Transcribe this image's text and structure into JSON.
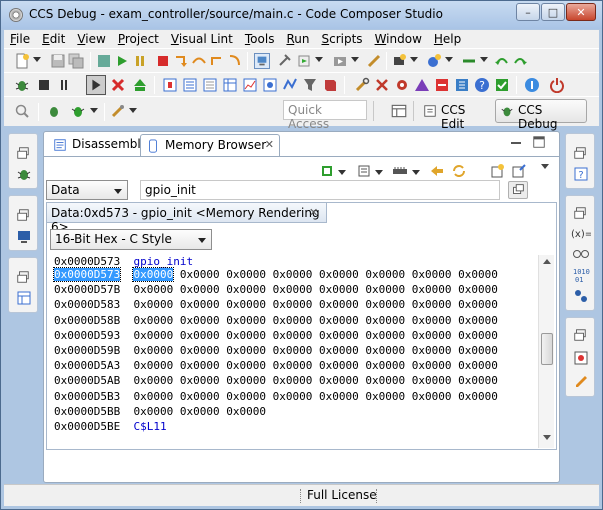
{
  "window": {
    "title": "CCS Debug - exam_controller/source/main.c - Code Composer Studio",
    "controls": [
      "–",
      "□",
      "✕"
    ]
  },
  "menu": [
    "File",
    "Edit",
    "View",
    "Project",
    "Visual Lint",
    "Tools",
    "Run",
    "Scripts",
    "Window",
    "Help"
  ],
  "toolbar": {
    "quick_access_placeholder": "Quick Access",
    "perspectives": [
      "CCS Edit",
      "CCS Debug"
    ]
  },
  "views": {
    "tabs": [
      "Disassembly",
      "Memory Browser"
    ],
    "close_glyph": "✕"
  },
  "memory": {
    "page_select": "Data",
    "address_input": "gpio_init",
    "rendering_tab": "Data:0xd573 - gpio_init <Memory Rendering 6>",
    "format_select": "16-Bit Hex - C Style",
    "symbol_label": "gpio_init",
    "end_label": "C$L11",
    "rows": [
      {
        "address": "0x0000D573",
        "selected": true,
        "values": [
          "0x0000",
          "0x0000",
          "0x0000",
          "0x0000",
          "0x0000",
          "0x0000",
          "0x0000",
          "0x0000"
        ]
      },
      {
        "address": "0x0000D57B",
        "values": [
          "0x0000",
          "0x0000",
          "0x0000",
          "0x0000",
          "0x0000",
          "0x0000",
          "0x0000",
          "0x0000"
        ]
      },
      {
        "address": "0x0000D583",
        "values": [
          "0x0000",
          "0x0000",
          "0x0000",
          "0x0000",
          "0x0000",
          "0x0000",
          "0x0000",
          "0x0000"
        ]
      },
      {
        "address": "0x0000D58B",
        "values": [
          "0x0000",
          "0x0000",
          "0x0000",
          "0x0000",
          "0x0000",
          "0x0000",
          "0x0000",
          "0x0000"
        ]
      },
      {
        "address": "0x0000D593",
        "values": [
          "0x0000",
          "0x0000",
          "0x0000",
          "0x0000",
          "0x0000",
          "0x0000",
          "0x0000",
          "0x0000"
        ]
      },
      {
        "address": "0x0000D59B",
        "values": [
          "0x0000",
          "0x0000",
          "0x0000",
          "0x0000",
          "0x0000",
          "0x0000",
          "0x0000",
          "0x0000"
        ]
      },
      {
        "address": "0x0000D5A3",
        "values": [
          "0x0000",
          "0x0000",
          "0x0000",
          "0x0000",
          "0x0000",
          "0x0000",
          "0x0000",
          "0x0000"
        ]
      },
      {
        "address": "0x0000D5AB",
        "values": [
          "0x0000",
          "0x0000",
          "0x0000",
          "0x0000",
          "0x0000",
          "0x0000",
          "0x0000",
          "0x0000"
        ]
      },
      {
        "address": "0x0000D5B3",
        "values": [
          "0x0000",
          "0x0000",
          "0x0000",
          "0x0000",
          "0x0000",
          "0x0000",
          "0x0000",
          "0x0000"
        ]
      },
      {
        "address": "0x0000D5BB",
        "values": [
          "0x0000",
          "0x0000",
          "0x0000"
        ]
      }
    ],
    "first_address": "0x0000D573",
    "last_address": "0x0000D5BE"
  },
  "status": {
    "license": "Full License"
  },
  "colors": {
    "selection": "#3399ff",
    "label": "#0000cc",
    "window_frame": "#aec6e2"
  }
}
